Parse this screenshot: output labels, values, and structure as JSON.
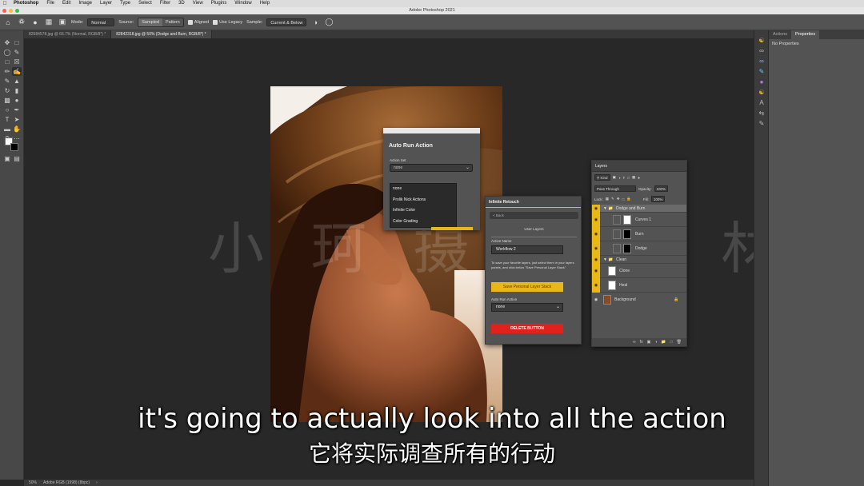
{
  "menubar": {
    "items": [
      "Photoshop",
      "File",
      "Edit",
      "Image",
      "Layer",
      "Type",
      "Select",
      "Filter",
      "3D",
      "View",
      "Plugins",
      "Window",
      "Help"
    ]
  },
  "window": {
    "title": "Adobe Photoshop 2021"
  },
  "options_bar": {
    "mode_label": "Mode:",
    "mode_value": "Normal",
    "source_label": "Source:",
    "source_options": [
      "Sampled",
      "Pattern"
    ],
    "aligned_label": "Aligned",
    "legacy_label": "Use Legacy",
    "sample_label": "Sample:",
    "sample_value": "Current & Below"
  },
  "doc_tabs": [
    "82584578.jpg @ 66.7% (Normal, RGB/8*) *",
    "82842318.jpg @ 50% (Dodge and Burn, RGB/8*) *"
  ],
  "right_panel": {
    "tabs": [
      "Actions",
      "Properties"
    ],
    "no_properties": "No Properties"
  },
  "auto_run_panel": {
    "title": "Auto Run Action",
    "field_label": "Action Set",
    "select_value": "none",
    "options": [
      "none",
      "Prolik Nick Actions",
      "Infinite Color",
      "Color Grading"
    ]
  },
  "infinite_panel": {
    "title": "Infinite Retouch",
    "back": "< Back",
    "user_layers": "User Layers",
    "active_name_label": "Active Name",
    "active_name_value": "Workflow 2",
    "description": "To save your favorite layers, just select them in your layers panels, and click below \"Save Personal Layer Stack\"",
    "save_button": "Save Personal Layer Stack",
    "auto_run_label": "Auto Run Action",
    "auto_run_value": "none",
    "delete_button": "DELETE BUTTON"
  },
  "layers_panel": {
    "title": "Layers",
    "kind": "Kind",
    "blend_mode": "Pass Through",
    "opacity_label": "Opacity:",
    "opacity_value": "100%",
    "lock_label": "Lock:",
    "fill_label": "Fill:",
    "fill_value": "100%",
    "layers": [
      "Dodge and Burn",
      "Curves 1",
      "Burn",
      "Dodge",
      "Clean",
      "Clone",
      "Heal",
      "Background"
    ]
  },
  "status_bar": {
    "zoom": "50%",
    "profile": "Adobe RGB (1998) (8bpc)"
  },
  "watermark": "小 珂 摄 影 素 材",
  "subtitles": {
    "english": "it's going to actually look into all the action",
    "chinese": "它将实际调查所有的行动"
  }
}
